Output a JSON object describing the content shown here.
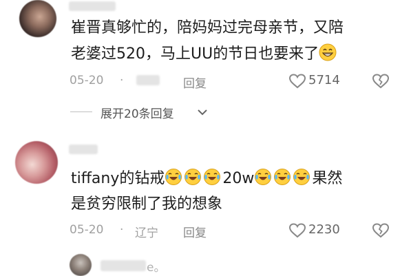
{
  "comments": [
    {
      "line1": "崔晋真够忙的，陪妈妈过完母亲节，又陪",
      "line2": "老婆过520，马上UU的节日也要来了",
      "date": "05-20",
      "dot": "·",
      "reply": "回复",
      "likes": "5714",
      "expand": "展开20条回复"
    },
    {
      "line1_pre": "tiffany的钻戒",
      "line1_mid": "20w",
      "line1_post": "果然",
      "line2": "是贫穷限制了我的想象",
      "date": "05-20",
      "dot": "·",
      "location": "辽宁",
      "reply": "回复",
      "likes": "2230"
    },
    {
      "name_tail": "e。"
    }
  ],
  "icons": {
    "like": "heart-outline-icon",
    "dislike": "broken-heart-icon",
    "expand": "chevron-down-icon",
    "emoji_grin": "grinning-emoji",
    "emoji_cry": "crying-laughing-emoji"
  }
}
